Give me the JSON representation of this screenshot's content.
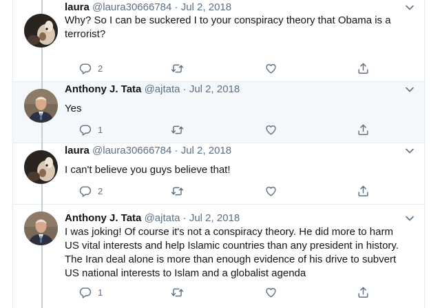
{
  "tweets": [
    {
      "name": "laura",
      "handle": "@laura30666784",
      "date": "Jul 2, 2018",
      "text_lines": [
        "Why?  So I can be suckered I to your conspiracy theory that Obama is a",
        "terrorist?"
      ],
      "reply_count": "2",
      "avatar_icon": "dog-avatar"
    },
    {
      "name": "Anthony J. Tata",
      "handle": "@ajtata",
      "date": "Jul 2, 2018",
      "text_lines": [
        "Yes"
      ],
      "reply_count": "1",
      "avatar_icon": "man-in-suit-avatar"
    },
    {
      "name": "laura",
      "handle": "@laura30666784",
      "date": "Jul 2, 2018",
      "text_lines": [
        "I can't believe you guys believe that!"
      ],
      "reply_count": "2",
      "avatar_icon": "dog-avatar"
    },
    {
      "name": "Anthony J. Tata",
      "handle": "@ajtata",
      "date": "Jul 2, 2018",
      "text_lines": [
        "I was joking! Of course it's not a conspiracy theory. He did more to harm",
        "US vital interests and help Islamic countries than any president in history.",
        "The Iran deal alone is more than enough evidence of his drive to subvert",
        "US national interests to Islam and a globalist agenda"
      ],
      "reply_count": "1",
      "avatar_icon": "man-in-suit-avatar"
    }
  ],
  "separator": " · ",
  "colors": {
    "icon": "#5b7083",
    "highlight_bg": "#f5f8fa",
    "border": "#e6ecf0",
    "thread_line": "#c4cfd6"
  }
}
